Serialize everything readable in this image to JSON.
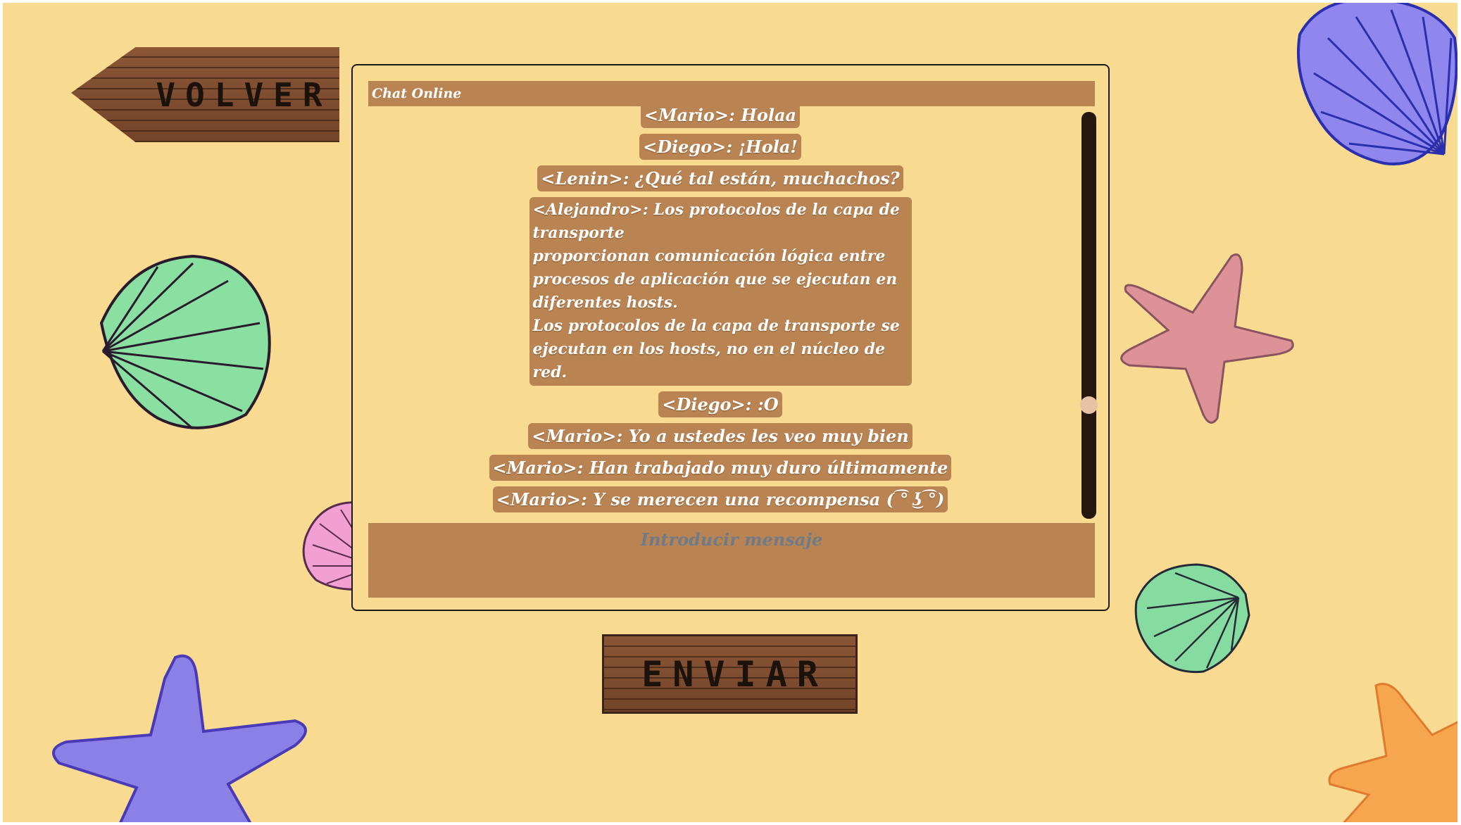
{
  "nav": {
    "back_label": "VOLVER"
  },
  "chat": {
    "header": "Chat Online",
    "messages": [
      "<Mario>: Holaa",
      "<Diego>: ¡Hola!",
      "<Lenin>: ¿Qué tal están, muchachos?",
      "<Alejandro>: Los protocolos de la capa de transporte\nproporcionan comunicación lógica entre\nprocesos de aplicación que se ejecutan en\ndiferentes hosts.\nLos protocolos de la capa de transporte se\nejecutan en los hosts, no en el núcleo de\nred.",
      "<Diego>: :O",
      "<Mario>: Yo a ustedes les veo muy bien",
      "<Mario>: Han trabajado muy duro últimamente",
      "<Mario>: Y se merecen una recompensa ( ͡° ͜ʖ ͡°)"
    ],
    "input_placeholder": "Introducir mensaje",
    "scroll_position": 0.73
  },
  "actions": {
    "send_label": "ENVIAR"
  },
  "theme": {
    "background": "#f8db90",
    "bubble": "#b98452",
    "wood": "#7d4b2f"
  },
  "decorations": [
    "blue-shell-icon",
    "green-shell-icon",
    "pink-shell-icon",
    "pink-starfish-icon",
    "green-shell-icon",
    "purple-starfish-icon",
    "orange-starfish-icon"
  ]
}
